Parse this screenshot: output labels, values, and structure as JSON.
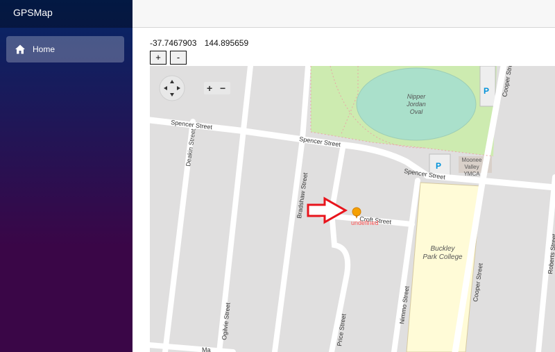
{
  "app": {
    "title": "GPSMap"
  },
  "sidebar": {
    "items": [
      {
        "label": "Home",
        "icon": "home-icon"
      }
    ]
  },
  "location": {
    "latitude": "-37.7467903",
    "longitude": "144.895659"
  },
  "zoom": {
    "in_label": "+",
    "out_label": "-"
  },
  "map": {
    "marker_label": "undefined",
    "streets": {
      "spencer_west": "Spencer Street",
      "spencer_mid": "Spencer Street",
      "spencer_east": "Spencer Street",
      "deakin": "Deakin Street",
      "bradshaw": "Bradshaw Street",
      "croft": "Croft Street",
      "ogilvie": "Ogilvie Street",
      "price": "Price Street",
      "nimmo": "Nimmo Street",
      "cooper_south": "Cooper Street",
      "cooper_north": "Cooper Street",
      "roberts": "Roberts Street",
      "partial_bottom": "Ma"
    },
    "places": {
      "oval_line1": "Nipper",
      "oval_line2": "Jordan",
      "oval_line3": "Oval",
      "ymca_line1": "Moonee",
      "ymca_line2": "Valley",
      "ymca_line3": "YMCA",
      "school_line1": "Buckley",
      "school_line2": "Park College",
      "parking": "P"
    },
    "controls": {
      "zoom_in": "+",
      "zoom_out": "−"
    }
  },
  "colors": {
    "accent_arrow": "#e8141c",
    "marker": "#f5a000",
    "park": "#cdebb0",
    "oval": "#aae0cb",
    "school": "#fffbd7"
  }
}
